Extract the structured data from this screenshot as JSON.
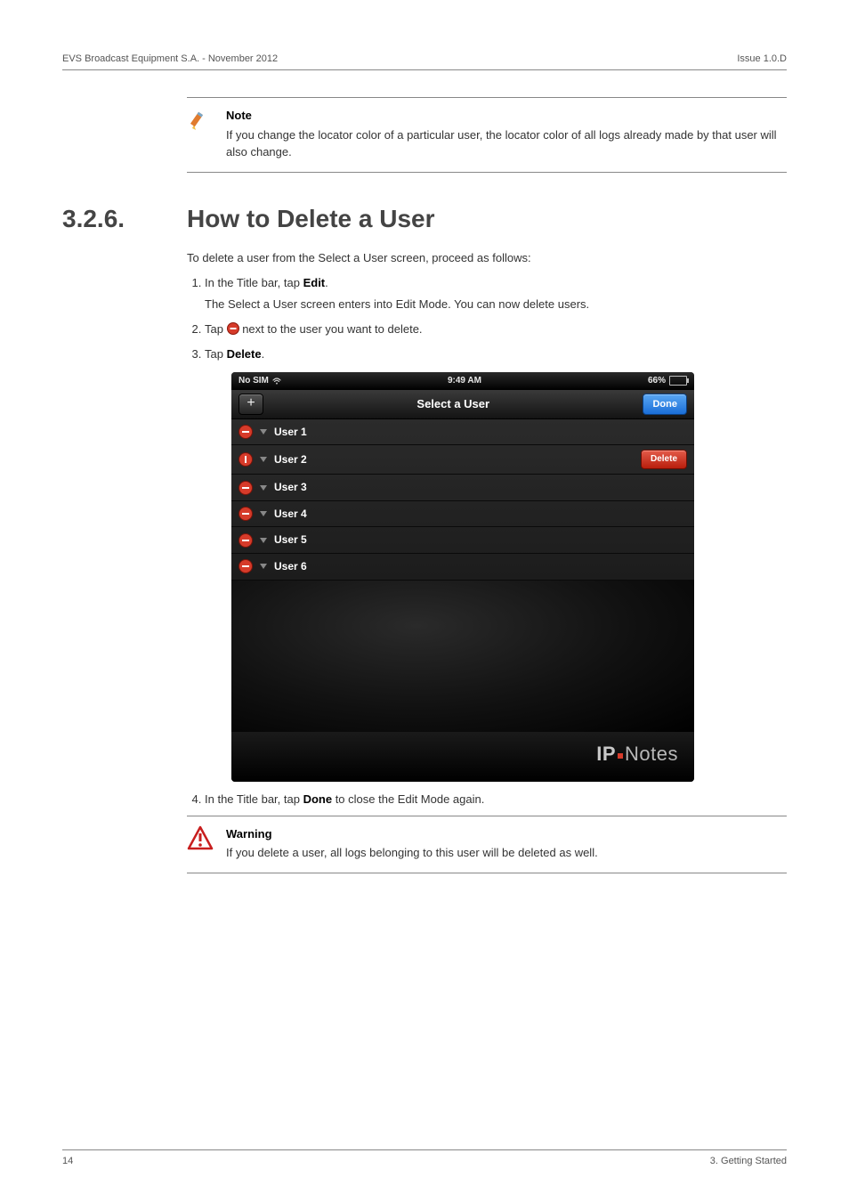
{
  "header": {
    "left": "EVS Broadcast Equipment S.A.  -  November 2012",
    "right": "Issue 1.0.D"
  },
  "callouts": {
    "note_title": "Note",
    "note_body": "If you change the locator color of a particular user, the locator color of all logs already made by that user will also change.",
    "warn_title": "Warning",
    "warn_body": "If you delete a user, all logs belonging to this user will be deleted as well."
  },
  "section": {
    "number": "3.2.6.",
    "title": "How to Delete a User"
  },
  "body": {
    "intro": "To delete a user from the Select a User screen, proceed as follows:",
    "step1_a": "In the Title bar, tap ",
    "step1_b": "Edit",
    "step1_c": ".",
    "step1_sub": "The Select a User screen enters into Edit Mode. You can now delete users.",
    "step2_a": "Tap ",
    "step2_b": " next to the user you want to delete.",
    "step3_a": "Tap ",
    "step3_b": "Delete",
    "step3_c": ".",
    "step4_a": "In the Title bar, tap ",
    "step4_b": "Done",
    "step4_c": " to close the Edit Mode again."
  },
  "app": {
    "status": {
      "left": "No SIM",
      "time": "9:49 AM",
      "battery_pct": "66%"
    },
    "nav": {
      "add": "+",
      "title": "Select a User",
      "done": "Done"
    },
    "delete_label": "Delete",
    "users": [
      {
        "name": "User 1",
        "rotated": false
      },
      {
        "name": "User 2",
        "rotated": true,
        "show_delete": true
      },
      {
        "name": "User 3",
        "rotated": false
      },
      {
        "name": "User 4",
        "rotated": false
      },
      {
        "name": "User 5",
        "rotated": false
      },
      {
        "name": "User 6",
        "rotated": false
      }
    ],
    "footer_brand": {
      "ip": "IP",
      "notes": "Notes"
    }
  },
  "footer": {
    "page": "14",
    "chapter": "3. Getting Started"
  }
}
